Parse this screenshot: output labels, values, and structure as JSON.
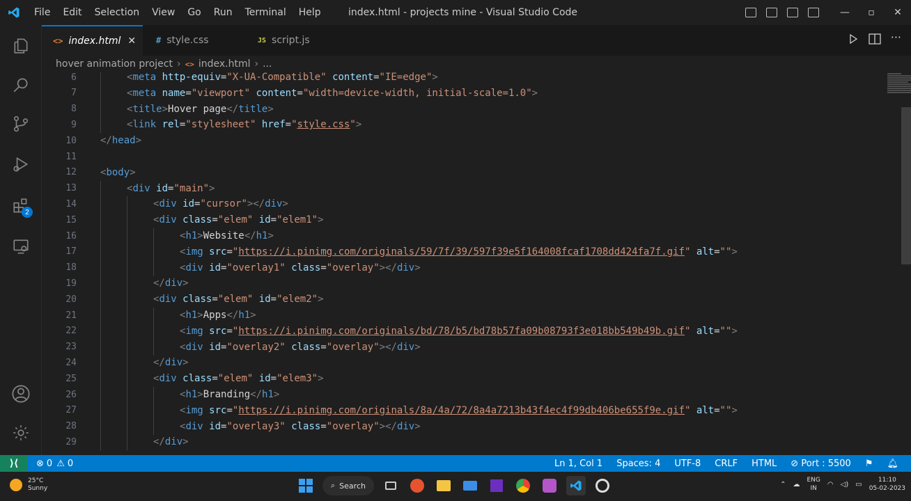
{
  "window": {
    "title": "index.html - projects mine - Visual Studio Code",
    "menu": [
      "File",
      "Edit",
      "Selection",
      "View",
      "Go",
      "Run",
      "Terminal",
      "Help"
    ],
    "controls": {
      "minimize": "—",
      "maximize": "▫",
      "close": "✕"
    }
  },
  "activity": {
    "icons": [
      "explorer-icon",
      "search-icon",
      "source-control-icon",
      "run-debug-icon",
      "extensions-icon",
      "remote-explorer-icon",
      "account-icon",
      "settings-gear-icon"
    ],
    "extensions_badge": "2"
  },
  "tabs": [
    {
      "label": "index.html",
      "icon": "<>",
      "icon_color": "#e37933",
      "active": true,
      "close": "✕"
    },
    {
      "label": "style.css",
      "icon": "#",
      "icon_color": "#519aba",
      "active": false
    },
    {
      "label": "script.js",
      "icon": "JS",
      "icon_color": "#cbcb41",
      "active": false
    }
  ],
  "breadcrumb": {
    "folder": "hover animation project",
    "file_icon": "<>",
    "file": "index.html",
    "rest": "..."
  },
  "editor": {
    "lines": [
      {
        "n": "6",
        "indent": 2,
        "html": "<span class='tok-p'>&lt;</span><span class='tok-t'>meta</span> <span class='tok-a'>http-equiv</span><span class='tok-x'>=</span><span class='tok-s'>\"X-UA-Compatible\"</span> <span class='tok-a'>content</span><span class='tok-x'>=</span><span class='tok-s'>\"IE=edge\"</span><span class='tok-p'>&gt;</span>"
      },
      {
        "n": "7",
        "indent": 2,
        "html": "<span class='tok-p'>&lt;</span><span class='tok-t'>meta</span> <span class='tok-a'>name</span><span class='tok-x'>=</span><span class='tok-s'>\"viewport\"</span> <span class='tok-a'>content</span><span class='tok-x'>=</span><span class='tok-s'>\"width=device-width, initial-scale=1.0\"</span><span class='tok-p'>&gt;</span>"
      },
      {
        "n": "8",
        "indent": 2,
        "html": "<span class='tok-p'>&lt;</span><span class='tok-t'>title</span><span class='tok-p'>&gt;</span><span class='tok-x'>Hover page</span><span class='tok-p'>&lt;/</span><span class='tok-t'>title</span><span class='tok-p'>&gt;</span>"
      },
      {
        "n": "9",
        "indent": 2,
        "html": "<span class='tok-p'>&lt;</span><span class='tok-t'>link</span> <span class='tok-a'>rel</span><span class='tok-x'>=</span><span class='tok-s'>\"stylesheet\"</span> <span class='tok-a'>href</span><span class='tok-x'>=</span><span class='tok-s'>\"</span><span class='tok-u'>style.css</span><span class='tok-s'>\"</span><span class='tok-p'>&gt;</span>"
      },
      {
        "n": "10",
        "indent": 1,
        "html": "<span class='tok-p'>&lt;/</span><span class='tok-t'>head</span><span class='tok-p'>&gt;</span>"
      },
      {
        "n": "11",
        "indent": 0,
        "html": ""
      },
      {
        "n": "12",
        "indent": 1,
        "html": "<span class='tok-p'>&lt;</span><span class='tok-t'>body</span><span class='tok-p'>&gt;</span>"
      },
      {
        "n": "13",
        "indent": 2,
        "html": "<span class='tok-p'>&lt;</span><span class='tok-t'>div</span> <span class='tok-a'>id</span><span class='tok-x'>=</span><span class='tok-s'>\"main\"</span><span class='tok-p'>&gt;</span>"
      },
      {
        "n": "14",
        "indent": 3,
        "html": "<span class='tok-p'>&lt;</span><span class='tok-t'>div</span> <span class='tok-a'>id</span><span class='tok-x'>=</span><span class='tok-s'>\"cursor\"</span><span class='tok-p'>&gt;&lt;/</span><span class='tok-t'>div</span><span class='tok-p'>&gt;</span>"
      },
      {
        "n": "15",
        "indent": 3,
        "html": "<span class='tok-p'>&lt;</span><span class='tok-t'>div</span> <span class='tok-a'>class</span><span class='tok-x'>=</span><span class='tok-s'>\"elem\"</span> <span class='tok-a'>id</span><span class='tok-x'>=</span><span class='tok-s'>\"elem1\"</span><span class='tok-p'>&gt;</span>"
      },
      {
        "n": "16",
        "indent": 4,
        "html": "<span class='tok-p'>&lt;</span><span class='tok-t'>h1</span><span class='tok-p'>&gt;</span><span class='tok-x'>Website</span><span class='tok-p'>&lt;/</span><span class='tok-t'>h1</span><span class='tok-p'>&gt;</span>"
      },
      {
        "n": "17",
        "indent": 4,
        "html": "<span class='tok-p'>&lt;</span><span class='tok-t'>img</span> <span class='tok-a'>src</span><span class='tok-x'>=</span><span class='tok-s'>\"</span><span class='tok-u'>https://i.pinimg.com/originals/59/7f/39/597f39e5f164008fcaf1708dd424fa7f.gif</span><span class='tok-s'>\"</span> <span class='tok-a'>alt</span><span class='tok-x'>=</span><span class='tok-s'>\"\"</span><span class='tok-p'>&gt;</span>"
      },
      {
        "n": "18",
        "indent": 4,
        "html": "<span class='tok-p'>&lt;</span><span class='tok-t'>div</span> <span class='tok-a'>id</span><span class='tok-x'>=</span><span class='tok-s'>\"overlay1\"</span> <span class='tok-a'>class</span><span class='tok-x'>=</span><span class='tok-s'>\"overlay\"</span><span class='tok-p'>&gt;&lt;/</span><span class='tok-t'>div</span><span class='tok-p'>&gt;</span>"
      },
      {
        "n": "19",
        "indent": 3,
        "html": "<span class='tok-p'>&lt;/</span><span class='tok-t'>div</span><span class='tok-p'>&gt;</span>"
      },
      {
        "n": "20",
        "indent": 3,
        "html": "<span class='tok-p'>&lt;</span><span class='tok-t'>div</span> <span class='tok-a'>class</span><span class='tok-x'>=</span><span class='tok-s'>\"elem\"</span> <span class='tok-a'>id</span><span class='tok-x'>=</span><span class='tok-s'>\"elem2\"</span><span class='tok-p'>&gt;</span>"
      },
      {
        "n": "21",
        "indent": 4,
        "html": "<span class='tok-p'>&lt;</span><span class='tok-t'>h1</span><span class='tok-p'>&gt;</span><span class='tok-x'>Apps</span><span class='tok-p'>&lt;/</span><span class='tok-t'>h1</span><span class='tok-p'>&gt;</span>"
      },
      {
        "n": "22",
        "indent": 4,
        "html": "<span class='tok-p'>&lt;</span><span class='tok-t'>img</span> <span class='tok-a'>src</span><span class='tok-x'>=</span><span class='tok-s'>\"</span><span class='tok-u'>https://i.pinimg.com/originals/bd/78/b5/bd78b57fa09b08793f3e018bb549b49b.gif</span><span class='tok-s'>\"</span> <span class='tok-a'>alt</span><span class='tok-x'>=</span><span class='tok-s'>\"\"</span><span class='tok-p'>&gt;</span>"
      },
      {
        "n": "23",
        "indent": 4,
        "html": "<span class='tok-p'>&lt;</span><span class='tok-t'>div</span> <span class='tok-a'>id</span><span class='tok-x'>=</span><span class='tok-s'>\"overlay2\"</span> <span class='tok-a'>class</span><span class='tok-x'>=</span><span class='tok-s'>\"overlay\"</span><span class='tok-p'>&gt;&lt;/</span><span class='tok-t'>div</span><span class='tok-p'>&gt;</span>"
      },
      {
        "n": "24",
        "indent": 3,
        "html": "<span class='tok-p'>&lt;/</span><span class='tok-t'>div</span><span class='tok-p'>&gt;</span>"
      },
      {
        "n": "25",
        "indent": 3,
        "html": "<span class='tok-p'>&lt;</span><span class='tok-t'>div</span> <span class='tok-a'>class</span><span class='tok-x'>=</span><span class='tok-s'>\"elem\"</span> <span class='tok-a'>id</span><span class='tok-x'>=</span><span class='tok-s'>\"elem3\"</span><span class='tok-p'>&gt;</span>"
      },
      {
        "n": "26",
        "indent": 4,
        "html": "<span class='tok-p'>&lt;</span><span class='tok-t'>h1</span><span class='tok-p'>&gt;</span><span class='tok-x'>Branding</span><span class='tok-p'>&lt;/</span><span class='tok-t'>h1</span><span class='tok-p'>&gt;</span>"
      },
      {
        "n": "27",
        "indent": 4,
        "html": "<span class='tok-p'>&lt;</span><span class='tok-t'>img</span> <span class='tok-a'>src</span><span class='tok-x'>=</span><span class='tok-s'>\"</span><span class='tok-u'>https://i.pinimg.com/originals/8a/4a/72/8a4a7213b43f4ec4f99db406be655f9e.gif</span><span class='tok-s'>\"</span> <span class='tok-a'>alt</span><span class='tok-x'>=</span><span class='tok-s'>\"\"</span><span class='tok-p'>&gt;</span>"
      },
      {
        "n": "28",
        "indent": 4,
        "html": "<span class='tok-p'>&lt;</span><span class='tok-t'>div</span> <span class='tok-a'>id</span><span class='tok-x'>=</span><span class='tok-s'>\"overlay3\"</span> <span class='tok-a'>class</span><span class='tok-x'>=</span><span class='tok-s'>\"overlay\"</span><span class='tok-p'>&gt;&lt;/</span><span class='tok-t'>div</span><span class='tok-p'>&gt;</span>"
      },
      {
        "n": "29",
        "indent": 3,
        "html": "<span class='tok-p'>&lt;/</span><span class='tok-t'>div</span><span class='tok-p'>&gt;</span>"
      }
    ]
  },
  "status": {
    "errors": "0",
    "warnings": "0",
    "position": "Ln 1, Col 1",
    "spaces": "Spaces: 4",
    "encoding": "UTF-8",
    "eol": "CRLF",
    "language": "HTML",
    "port": "Port : 5500"
  },
  "taskbar": {
    "weather_temp": "25°C",
    "weather_desc": "Sunny",
    "search_label": "Search",
    "lang_top": "ENG",
    "lang_bottom": "IN",
    "time": "11:10",
    "date": "05-02-2023"
  },
  "colors": {
    "accent": "#007acc",
    "remote": "#16825d",
    "tab_border": "#0078d4"
  }
}
